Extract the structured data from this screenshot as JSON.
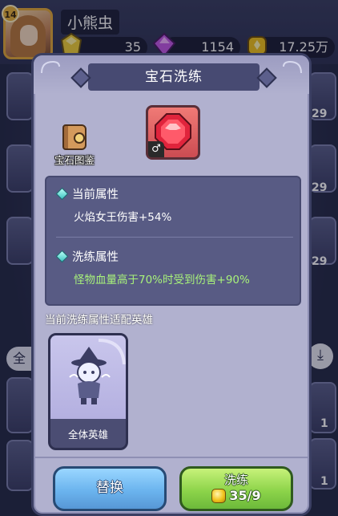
{
  "player": {
    "level": "14",
    "name": "小熊虫"
  },
  "resources": [
    {
      "icon": "gold-crystal-icon",
      "value": "35"
    },
    {
      "icon": "purple-gem-icon",
      "value": "1154"
    },
    {
      "icon": "gold-coin-icon",
      "value": "17.25万"
    }
  ],
  "background": {
    "side_counts_right": [
      "29",
      "29",
      "29"
    ],
    "side_counts_bottom": [
      "1",
      "1"
    ],
    "tab_label": "全"
  },
  "modal": {
    "title": "宝石洗练",
    "codex_label": "宝石图鉴",
    "gem_tag": "♂",
    "current_attr": {
      "heading": "当前属性",
      "value": "火焰女王伤害+54%"
    },
    "refine_attr": {
      "heading": "洗练属性",
      "value": "怪物血量高于70%时受到伤害+90%"
    },
    "hero_section_title": "当前洗练属性适配英雄",
    "hero_card": {
      "name": "全体英雄"
    },
    "buttons": {
      "replace_label": "替换",
      "refine_label": "洗练",
      "refine_cost": "35/9"
    }
  },
  "colors": {
    "current_value": "#ffffff",
    "refine_value": "#a8f27a",
    "modal_bg": "#b1b1cf",
    "panel_bg": "#585b84"
  }
}
